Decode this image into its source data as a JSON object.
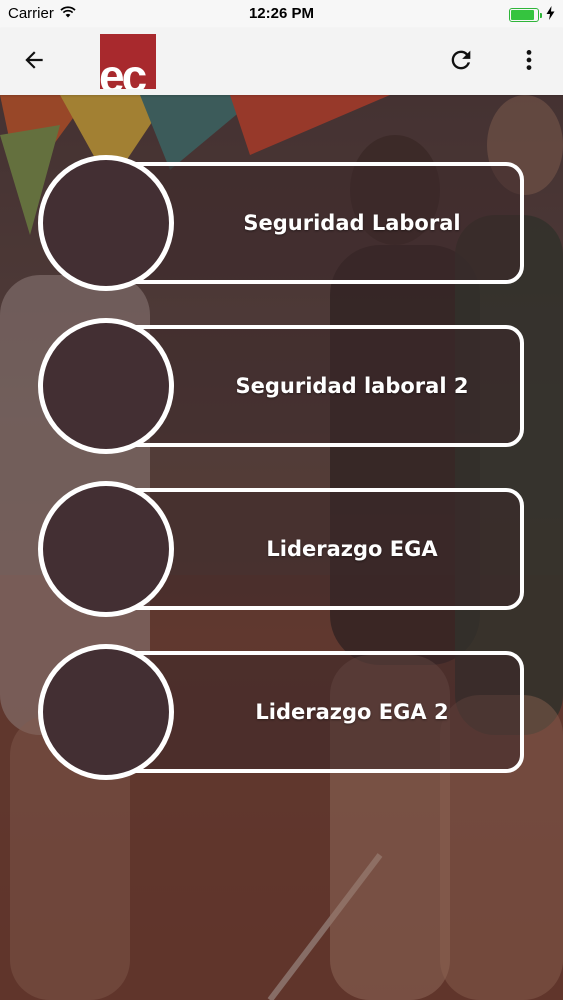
{
  "status_bar": {
    "carrier": "Carrier",
    "time": "12:26 PM",
    "battery_level": 0.9,
    "wifi_icon": "wifi-icon",
    "battery_icon": "battery-icon",
    "charging_icon": "charging-bolt-icon"
  },
  "app_bar": {
    "back_icon": "arrow-left-icon",
    "logo_text": "ec",
    "logo_color": "#a8292d",
    "refresh_icon": "refresh-icon",
    "more_icon": "more-vertical-icon"
  },
  "menu": {
    "items": [
      {
        "label": "Seguridad Laboral"
      },
      {
        "label": "Seguridad laboral 2"
      },
      {
        "label": "Liderazgo EGA"
      },
      {
        "label": "Liderazgo EGA 2"
      }
    ]
  },
  "colors": {
    "circle_fill": "#432f33",
    "border": "#ffffff",
    "text": "#ffffff"
  }
}
